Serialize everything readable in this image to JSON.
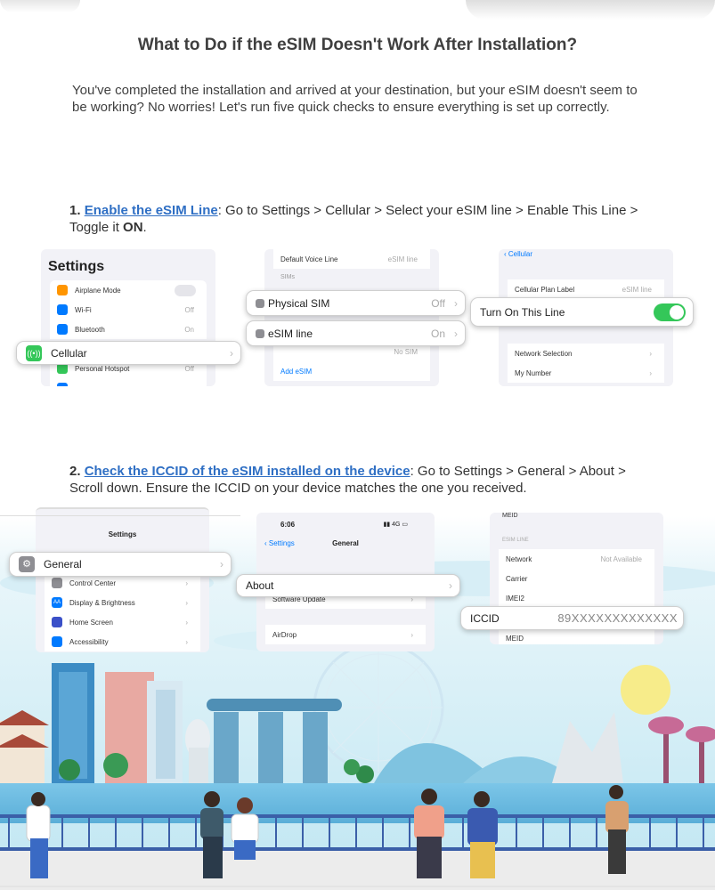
{
  "heading": "What to Do if the eSIM Doesn't Work After Installation?",
  "intro": "You've completed the installation and arrived at your destination, but your eSIM doesn't seem to be working? No worries! Let's run five quick checks to ensure everything is set up correctly.",
  "step1": {
    "number": "1.",
    "link": "Enable the eSIM Line",
    "text_a": ": Go to Settings > Cellular > Select your eSIM line > Enable This Line > Toggle it ",
    "bold_end": "ON",
    "text_b": ".",
    "panel1": {
      "title": "Settings",
      "rows": [
        {
          "label": "Airplane Mode",
          "value": ""
        },
        {
          "label": "Wi-Fi",
          "value": "Off"
        },
        {
          "label": "Bluetooth",
          "value": "On"
        },
        {
          "label": "Personal Hotspot",
          "value": "Off"
        }
      ],
      "callout": "Cellular"
    },
    "panel2": {
      "top_row": "Default Voice Line",
      "top_value": "eSIM line",
      "section": "SIMs",
      "callout1_label": "Physical SIM",
      "callout1_value": "Off",
      "callout2_label": "eSIM line",
      "callout2_value": "On",
      "hidden_value": "No SIM",
      "add_esim": "Add eSIM"
    },
    "panel3": {
      "back": "Cellular",
      "plan_label": "Cellular Plan Label",
      "plan_value": "eSIM line",
      "callout": "Turn On This Line",
      "network_selection": "Network Selection",
      "my_number": "My Number"
    }
  },
  "step2": {
    "number": "2.",
    "link": "Check the ICCID of the eSIM installed on the device",
    "text": ": Go to Settings > General > About > Scroll down. Ensure the ICCID on your device matches the one you received.",
    "panel1": {
      "title": "Settings",
      "callout": "General",
      "rows": [
        "Control Center",
        "Display & Brightness",
        "Home Screen",
        "Accessibility"
      ]
    },
    "panel2": {
      "time": "6:06",
      "signal": "4G",
      "back": "Settings",
      "title": "General",
      "callout": "About",
      "software_update": "Software Update",
      "airdrop": "AirDrop"
    },
    "panel3": {
      "meid_top": "MEID",
      "section": "ESIM LINE",
      "network": "Network",
      "network_value": "Not Available",
      "carrier": "Carrier",
      "imei2": "IMEI2",
      "callout_label": "ICCID",
      "callout_value": "89XXXXXXXXXXXXX",
      "meid": "MEID"
    }
  },
  "colors": {
    "link": "#2f6fc4",
    "toggle_on": "#34c759",
    "sky": "#bfe6f2",
    "water": "#7cc6e8"
  }
}
